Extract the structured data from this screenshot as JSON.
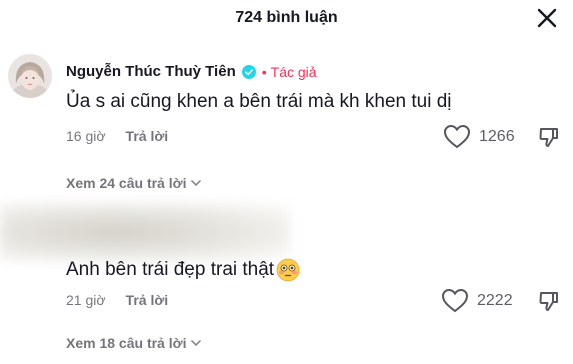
{
  "header": {
    "title": "724 bình luận"
  },
  "comments": [
    {
      "author": "Nguyễn Thúc Thuỳ Tiên",
      "verified": true,
      "author_tag": "Tác giả",
      "text": "Ủa s ai cũng khen a bên trái mà kh khen tui dị",
      "time": "16 giờ",
      "reply_label": "Trả lời",
      "likes": "1266",
      "view_replies": "Xem 24 câu trả lời"
    },
    {
      "author": "",
      "text": "Anh bên trái đẹp trai thật",
      "emoji": "flushed-face",
      "time": "21 giờ",
      "reply_label": "Trả lời",
      "likes": "2222",
      "view_replies": "Xem 18 câu trả lời"
    }
  ],
  "colors": {
    "verified": "#20d5ec",
    "author_tag": "#fe2c55",
    "muted_text": "#8a8b91"
  }
}
